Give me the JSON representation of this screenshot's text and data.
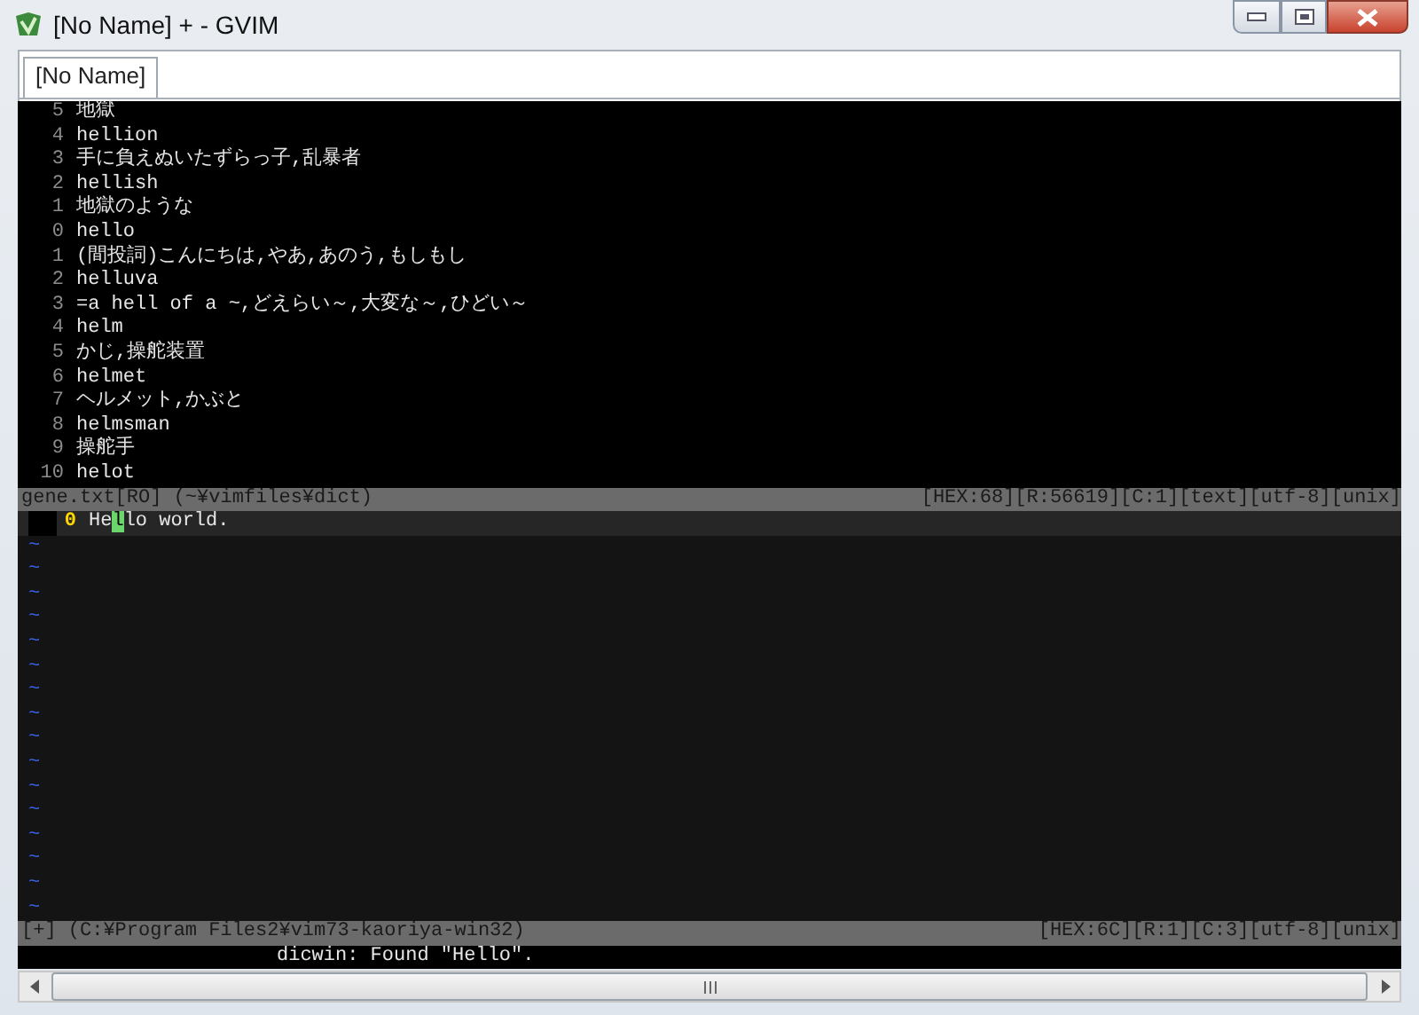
{
  "window": {
    "title": "[No Name] + - GVIM"
  },
  "tabs": [
    {
      "label": "[No Name]",
      "selected": true
    }
  ],
  "upper_pane": {
    "lines": [
      {
        "number": "5",
        "text": "地獄"
      },
      {
        "number": "4",
        "text": "hellion"
      },
      {
        "number": "3",
        "text": "手に負えぬいたずらっ子,乱暴者"
      },
      {
        "number": "2",
        "text": "hellish"
      },
      {
        "number": "1",
        "text": "地獄のような"
      },
      {
        "number": "0",
        "text": "hello"
      },
      {
        "number": "1",
        "text": "(間投詞)こんにちは,やあ,あのう,もしもし"
      },
      {
        "number": "2",
        "text": "helluva"
      },
      {
        "number": "3",
        "text": "=a hell of a ~,どえらい～,大変な～,ひどい～"
      },
      {
        "number": "4",
        "text": "helm"
      },
      {
        "number": "5",
        "text": "かじ,操舵装置"
      },
      {
        "number": "6",
        "text": "helmet"
      },
      {
        "number": "7",
        "text": "ヘルメット,かぶと"
      },
      {
        "number": "8",
        "text": "helmsman"
      },
      {
        "number": "9",
        "text": "操舵手"
      },
      {
        "number": "10",
        "text": "helot"
      }
    ],
    "status_line": {
      "left": "gene.txt[RO] (~¥vimfiles¥dict)",
      "right": "[HEX:68][R:56619][C:1][text][utf-8][unix]"
    }
  },
  "lower_pane": {
    "lines": [
      {
        "number": "0",
        "before_cursor": "He",
        "cursor": "l",
        "after_cursor": "lo world.",
        "current": true
      }
    ],
    "filler": [
      "~",
      "~",
      "~",
      "~",
      "~",
      "~",
      "~",
      "~",
      "~",
      "~",
      "~",
      "~",
      "~",
      "~",
      "~",
      "~"
    ],
    "status_line": {
      "left": "[+] (C:¥Program Files2¥vim73-kaoriya-win32)",
      "right": "[HEX:6C][R:1][C:3][utf-8][unix]"
    }
  },
  "message": "dicwin: Found \"Hello\"."
}
